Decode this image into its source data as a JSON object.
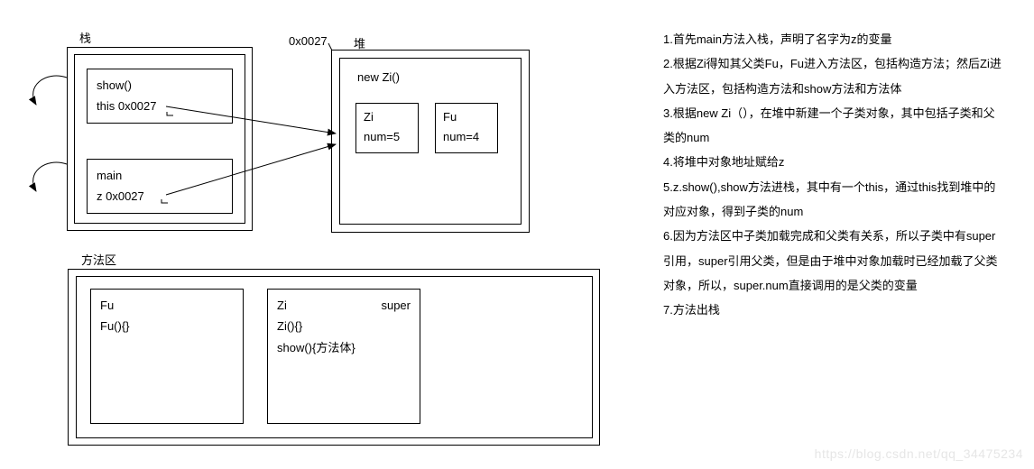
{
  "stack": {
    "label": "栈",
    "frame_show": {
      "line1": "show()",
      "line2": "this  0x0027"
    },
    "frame_main": {
      "line1": "main",
      "line2": "z   0x0027"
    }
  },
  "heap": {
    "label": "堆",
    "address": "0x0027",
    "new_label": "new Zi()",
    "zi": {
      "name": "Zi",
      "num": "num=5"
    },
    "fu": {
      "name": "Fu",
      "num": "num=4"
    }
  },
  "method_area": {
    "label": "方法区",
    "fu_box": {
      "line1": "Fu",
      "line2": "Fu(){}"
    },
    "zi_box": {
      "super_label": "super",
      "line1": "Zi",
      "line2": "Zi(){}",
      "line3": "show(){方法体}"
    }
  },
  "notes": {
    "n1": "1.首先main方法入栈，声明了名字为z的变量",
    "n2": "2.根据Zi得知其父类Fu，Fu进入方法区，包括构造方法；然后Zi进入方法区，包括构造方法和show方法和方法体",
    "n3": "3.根据new Zi（），在堆中新建一个子类对象，其中包括子类和父类的num",
    "n4": "4.将堆中对象地址赋给z",
    "n5": "5.z.show(),show方法进栈，其中有一个this，通过this找到堆中的对应对象，得到子类的num",
    "n6": "6.因为方法区中子类加载完成和父类有关系，所以子类中有super引用，super引用父类，但是由于堆中对象加载时已经加载了父类对象，所以，super.num直接调用的是父类的变量",
    "n7": "7.方法出栈"
  },
  "watermark": "https://blog.csdn.net/qq_34475234"
}
